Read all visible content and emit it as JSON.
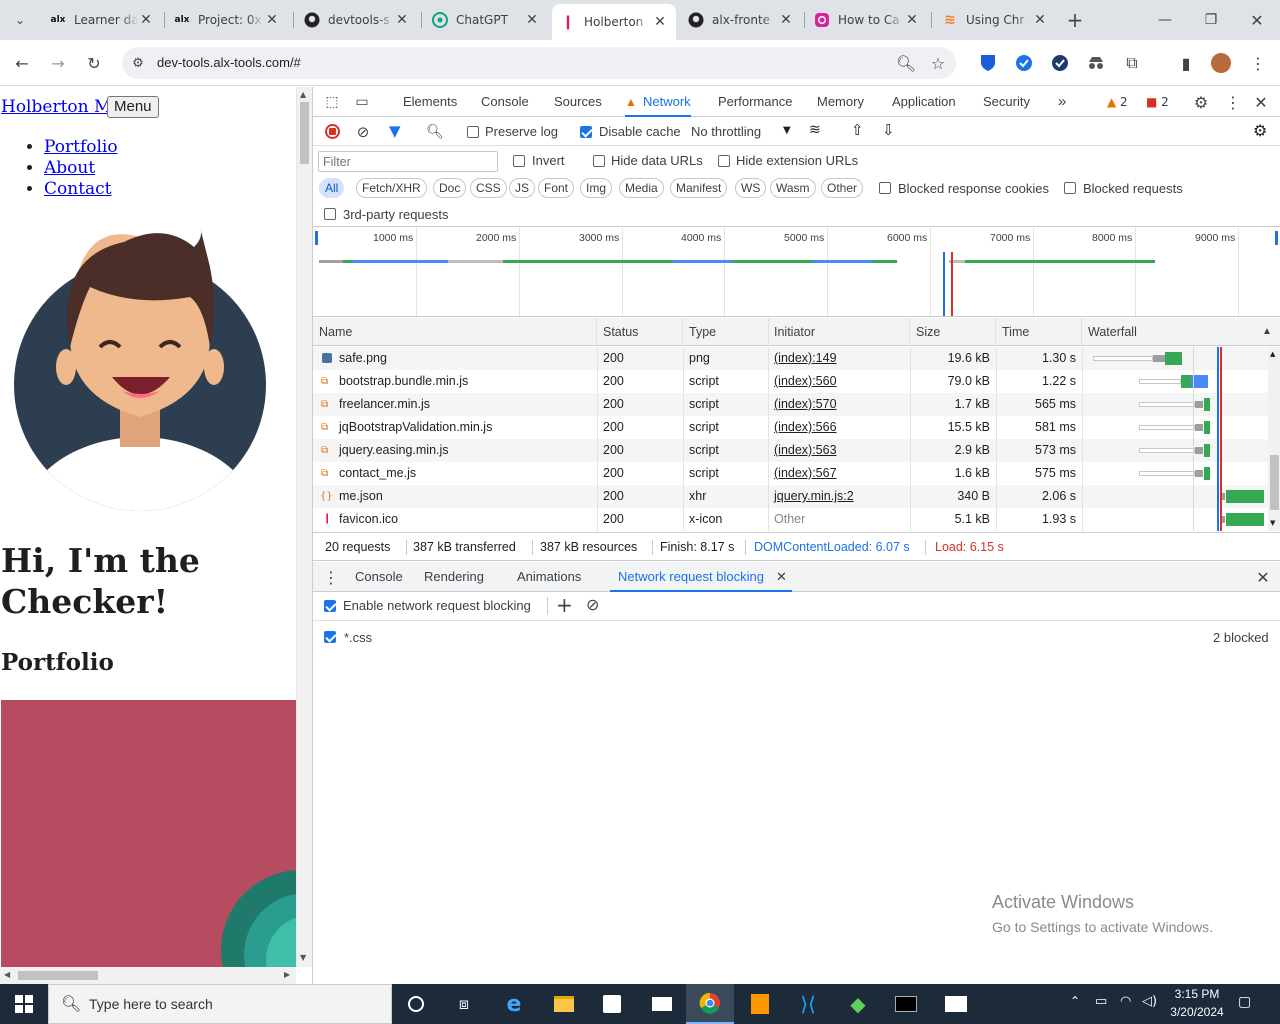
{
  "tabs": [
    {
      "title": "Learner da",
      "icon": "alx-icon"
    },
    {
      "title": "Project: 0x",
      "icon": "alx-icon"
    },
    {
      "title": "devtools-s",
      "icon": "github-icon"
    },
    {
      "title": "ChatGPT",
      "icon": "chatgpt-icon"
    },
    {
      "title": "Holberton",
      "icon": "holberton-icon"
    },
    {
      "title": "alx-fronte",
      "icon": "github-icon"
    },
    {
      "title": "How to Ca",
      "icon": "instagram-icon"
    },
    {
      "title": "Using Chr",
      "icon": "stackoverflow-icon"
    }
  ],
  "address": "dev-tools.alx-tools.com/#",
  "page": {
    "brand": "Holberton Me",
    "menu_button": "Menu",
    "nav": [
      "Portfolio",
      "About",
      "Contact"
    ],
    "hero": "Hi, I'm the Checker!",
    "portfolio_heading": "Portfolio"
  },
  "devtools": {
    "tabs": [
      "Elements",
      "Console",
      "Sources",
      "Network",
      "Performance",
      "Memory",
      "Application",
      "Security"
    ],
    "active_tab": "Network",
    "warnings": "2",
    "errors": "2",
    "preserve_log": "Preserve log",
    "disable_cache": "Disable cache",
    "throttling": "No throttling",
    "filter_placeholder": "Filter",
    "invert": "Invert",
    "hide_data_urls": "Hide data URLs",
    "hide_ext_urls": "Hide extension URLs",
    "type_filters": [
      "All",
      "Fetch/XHR",
      "Doc",
      "CSS",
      "JS",
      "Font",
      "Img",
      "Media",
      "Manifest",
      "WS",
      "Wasm",
      "Other"
    ],
    "blocked_response_cookies": "Blocked response cookies",
    "blocked_requests": "Blocked requests",
    "third_party": "3rd-party requests",
    "timeline_ticks": [
      "1000 ms",
      "2000 ms",
      "3000 ms",
      "4000 ms",
      "5000 ms",
      "6000 ms",
      "7000 ms",
      "8000 ms",
      "9000 ms"
    ],
    "columns": [
      "Name",
      "Status",
      "Type",
      "Initiator",
      "Size",
      "Time",
      "Waterfall"
    ],
    "rows": [
      {
        "name": "safe.png",
        "status": "200",
        "type": "png",
        "initiator": "(index):149",
        "size": "19.6 kB",
        "time": "1.30 s"
      },
      {
        "name": "bootstrap.bundle.min.js",
        "status": "200",
        "type": "script",
        "initiator": "(index):560",
        "size": "79.0 kB",
        "time": "1.22 s"
      },
      {
        "name": "freelancer.min.js",
        "status": "200",
        "type": "script",
        "initiator": "(index):570",
        "size": "1.7 kB",
        "time": "565 ms"
      },
      {
        "name": "jqBootstrapValidation.min.js",
        "status": "200",
        "type": "script",
        "initiator": "(index):566",
        "size": "15.5 kB",
        "time": "581 ms"
      },
      {
        "name": "jquery.easing.min.js",
        "status": "200",
        "type": "script",
        "initiator": "(index):563",
        "size": "2.9 kB",
        "time": "573 ms"
      },
      {
        "name": "contact_me.js",
        "status": "200",
        "type": "script",
        "initiator": "(index):567",
        "size": "1.6 kB",
        "time": "575 ms"
      },
      {
        "name": "me.json",
        "status": "200",
        "type": "xhr",
        "initiator": "jquery.min.js:2",
        "size": "340 B",
        "time": "2.06 s"
      },
      {
        "name": "favicon.ico",
        "status": "200",
        "type": "x-icon",
        "initiator": "Other",
        "size": "5.1 kB",
        "time": "1.93 s"
      }
    ],
    "summary": {
      "requests": "20 requests",
      "transferred": "387 kB transferred",
      "resources": "387 kB resources",
      "finish": "Finish: 8.17 s",
      "dcl": "DOMContentLoaded: 6.07 s",
      "load": "Load: 6.15 s"
    },
    "drawer_tabs": [
      "Console",
      "Rendering",
      "Animations",
      "Network request blocking"
    ],
    "enable_blocking": "Enable network request blocking",
    "pattern": "*.css",
    "pattern_count": "2 blocked",
    "colors": {
      "accent": "#1a73e8",
      "dcl": "#1a73e8",
      "load": "#d93025"
    }
  },
  "watermark": {
    "title": "Activate Windows",
    "subtitle": "Go to Settings to activate Windows."
  },
  "taskbar": {
    "search_placeholder": "Type here to search",
    "time": "3:15 PM",
    "date": "3/20/2024"
  }
}
